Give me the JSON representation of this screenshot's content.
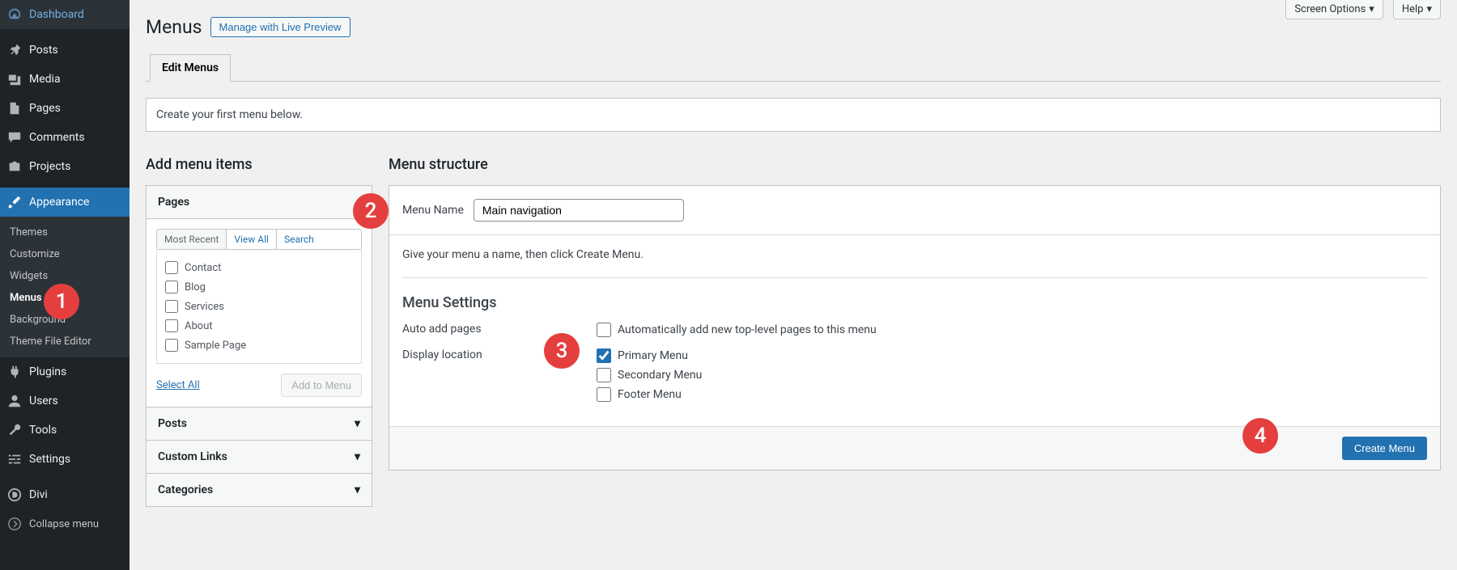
{
  "sidebar": {
    "items": [
      {
        "label": "Dashboard"
      },
      {
        "label": "Posts"
      },
      {
        "label": "Media"
      },
      {
        "label": "Pages"
      },
      {
        "label": "Comments"
      },
      {
        "label": "Projects"
      },
      {
        "label": "Appearance"
      },
      {
        "label": "Plugins"
      },
      {
        "label": "Users"
      },
      {
        "label": "Tools"
      },
      {
        "label": "Settings"
      },
      {
        "label": "Divi"
      }
    ],
    "submenu": [
      {
        "label": "Themes"
      },
      {
        "label": "Customize"
      },
      {
        "label": "Widgets"
      },
      {
        "label": "Menus"
      },
      {
        "label": "Background"
      },
      {
        "label": "Theme File Editor"
      }
    ],
    "collapse": "Collapse menu"
  },
  "top": {
    "screen_options": "Screen Options",
    "help": "Help"
  },
  "header": {
    "title": "Menus",
    "action": "Manage with Live Preview"
  },
  "tab": {
    "edit": "Edit Menus"
  },
  "notice": "Create your first menu below.",
  "left": {
    "title": "Add menu items",
    "panels": {
      "pages": "Pages",
      "posts": "Posts",
      "custom": "Custom Links",
      "categories": "Categories"
    },
    "tabs": {
      "recent": "Most Recent",
      "all": "View All",
      "search": "Search"
    },
    "items": [
      "Contact",
      "Blog",
      "Services",
      "About",
      "Sample Page"
    ],
    "select_all": "Select All",
    "add": "Add to Menu"
  },
  "right": {
    "title": "Menu structure",
    "name_label": "Menu Name",
    "name_value": "Main navigation",
    "hint": "Give your menu a name, then click Create Menu.",
    "settings_title": "Menu Settings",
    "auto_label": "Auto add pages",
    "auto_opt": "Automatically add new top-level pages to this menu",
    "loc_label": "Display location",
    "loc_opts": [
      "Primary Menu",
      "Secondary Menu",
      "Footer Menu"
    ],
    "create": "Create Menu"
  },
  "annotations": [
    "1",
    "2",
    "3",
    "4"
  ]
}
